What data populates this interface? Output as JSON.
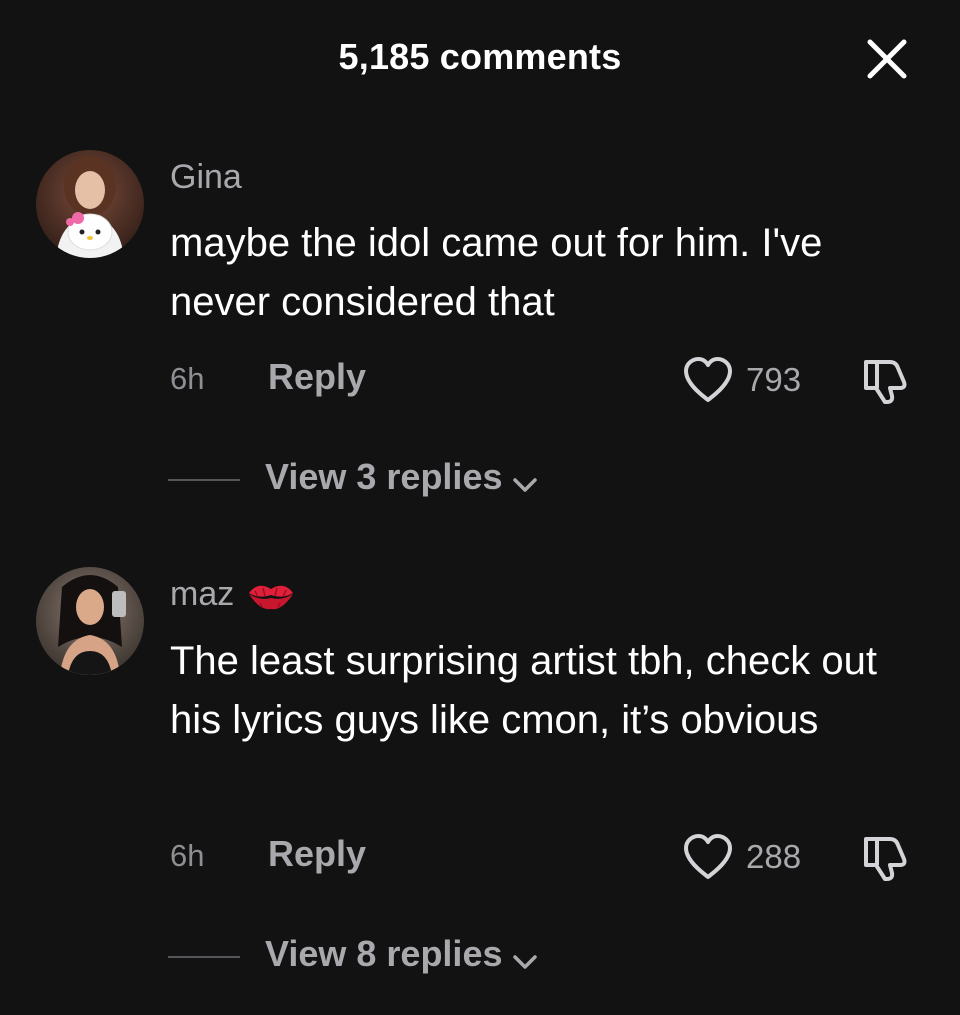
{
  "header": {
    "title": "5,185 comments",
    "close_icon": "close-icon"
  },
  "comments": [
    {
      "username": "Gina",
      "text": "maybe the idol came out for him. I've never considered that",
      "time": "6h",
      "reply_label": "Reply",
      "likes": "793",
      "view_replies": "View 3 replies"
    },
    {
      "username": "maz",
      "username_emoji": "kiss-mark-icon",
      "text": "The least surprising artist tbh, check out his lyrics guys like cmon, it’s obvious",
      "time": "6h",
      "reply_label": "Reply",
      "likes": "288",
      "view_replies": "View 8 replies"
    }
  ],
  "colors": {
    "background": "#121212",
    "primary_text": "#ffffff",
    "secondary_text": "#a9a9ad",
    "muted_text": "#8e8e93",
    "kiss_red": "#e0203a"
  }
}
